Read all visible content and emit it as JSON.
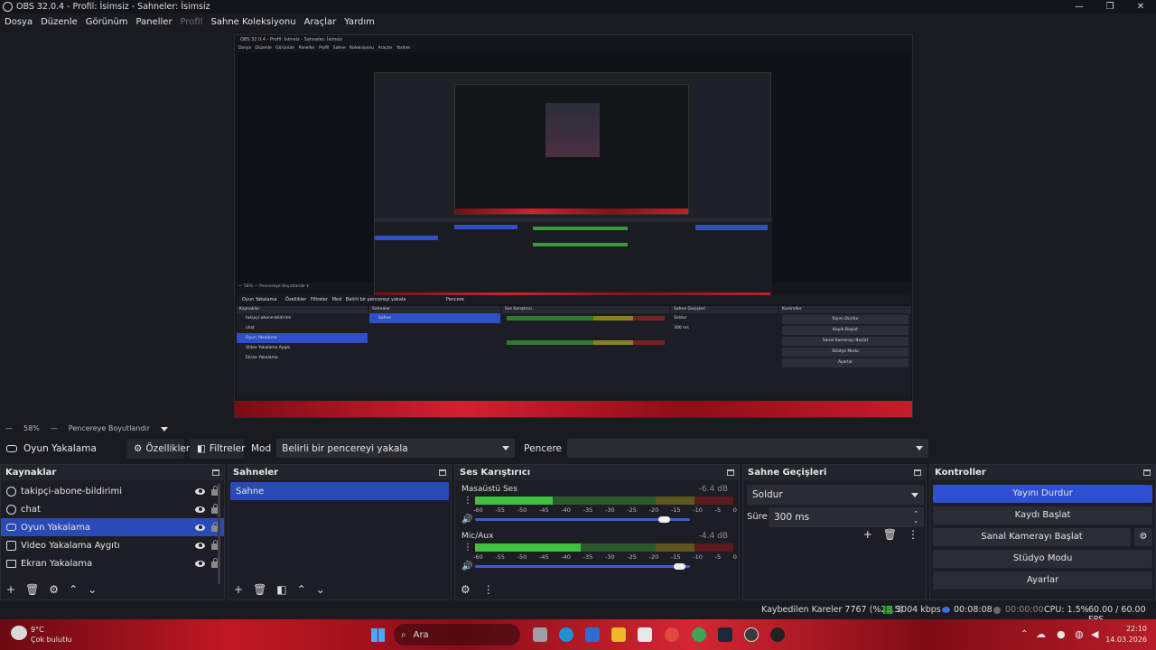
{
  "window": {
    "title": "OBS 32.0.4 - Profil: İsimsiz - Sahneler: İsimsiz",
    "minimize": "—",
    "maximize": "❐",
    "close": "✕"
  },
  "menu": [
    "Dosya",
    "Düzenle",
    "Görünüm",
    "Paneller",
    "Profil",
    "Sahne Koleksiyonu",
    "Araçlar",
    "Yardım"
  ],
  "preview": {
    "nested_title": "OBS 32.0.4 - Profil: İsimsiz - Sahneler: İsimsiz",
    "nested_menu": "Dosya Düzenle Görünüm Paneller Profil Sahne Koleksiyonu Araçlar Yardım",
    "nested_docks": [
      "Kaynaklar",
      "Sahneler",
      "Ses Karıştırıcı",
      "Sahne Geçişleri",
      "Kontroller"
    ]
  },
  "zoom": {
    "level": "58%",
    "mode": "Pencereye Boyutlandır"
  },
  "context": {
    "source_name": "Oyun Yakalama",
    "properties": "Özellikler",
    "filters": "Filtreler",
    "mode_label": "Mod",
    "mode_value": "Belirli bir pencereyi yakala",
    "window_label": "Pencere",
    "window_value": ""
  },
  "sources": {
    "title": "Kaynaklar",
    "items": [
      {
        "label": "takipçi-abone-bildirimi",
        "selected": false
      },
      {
        "label": "chat",
        "selected": false
      },
      {
        "label": "Oyun Yakalama",
        "selected": true
      },
      {
        "label": "Video Yakalama Aygıtı",
        "selected": false
      },
      {
        "label": "Ekran Yakalama",
        "selected": false
      }
    ]
  },
  "scenes": {
    "title": "Sahneler",
    "items": [
      {
        "label": "Sahne",
        "selected": true
      }
    ]
  },
  "mixer": {
    "title": "Ses Karıştırıcı",
    "scale": [
      "-60",
      "-55",
      "-50",
      "-45",
      "-40",
      "-35",
      "-30",
      "-25",
      "-20",
      "-15",
      "-10",
      "-5",
      "0"
    ],
    "channels": [
      {
        "name": "Masaüstü Ses",
        "db": "-6.4 dB",
        "level": 0.3,
        "volume": 0.88
      },
      {
        "name": "Mic/Aux",
        "db": "-4.4 dB",
        "level": 0.41,
        "volume": 0.95
      }
    ]
  },
  "transitions": {
    "title": "Sahne Geçişleri",
    "type": "Soldur",
    "duration_label": "Süre",
    "duration_value": "300 ms"
  },
  "controls": {
    "title": "Kontroller",
    "buttons": [
      "Yayını Durdur",
      "Kaydı Başlat",
      "Sanal Kamerayı Başlat",
      "Stüdyo Modu",
      "Ayarlar"
    ]
  },
  "status": {
    "dropped": "Kaybedilen Kareler 7767 (%26.5)",
    "bitrate": "3004 kbps",
    "stream_time": "00:08:08",
    "record_time": "00:00:00",
    "cpu": "CPU: 1.5%",
    "fps": "60.00 / 60.00 FPS"
  },
  "taskbar": {
    "weather_temp": "9°C",
    "weather_desc": "Çok bulutlu",
    "search": "Ara",
    "time": "22:10",
    "date": "14.03.2026"
  },
  "colors": {
    "accent": "#2e4fd0",
    "panel": "#1d1e25",
    "meter_green": "#3fc33f",
    "meter_yellow": "#b6a92a",
    "meter_red": "#b8262e"
  }
}
